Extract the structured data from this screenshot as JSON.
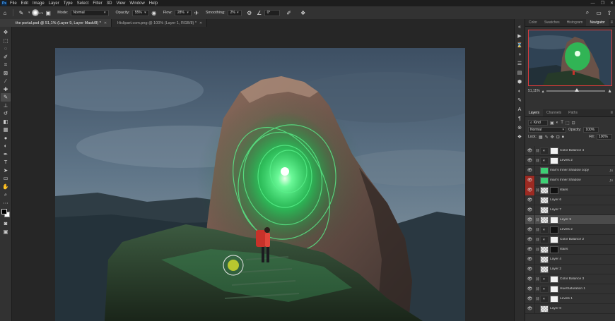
{
  "menubar": {
    "logo": "Ps",
    "items": [
      "File",
      "Edit",
      "Image",
      "Layer",
      "Type",
      "Select",
      "Filter",
      "3D",
      "View",
      "Window",
      "Help"
    ],
    "window_controls": [
      "—",
      "❐",
      "✕"
    ]
  },
  "options": {
    "brush_size": "175",
    "mode_label": "Mode:",
    "mode_value": "Normal",
    "opacity_label": "Opacity:",
    "opacity_value": "55%",
    "flow_label": "Flow:",
    "flow_value": "28%",
    "smoothing_label": "Smoothing:",
    "smoothing_value": "2%",
    "angle_value": "0°"
  },
  "tabs": [
    {
      "label": "the portal.psd @ 51,1% (Layer 9, Layer Mask/8) *",
      "active": true
    },
    {
      "label": "Hiclipart.com.png @ 100% (Layer 1, RGB/8) *",
      "active": false
    }
  ],
  "panels": {
    "top_tabs": [
      "Color",
      "Swatches",
      "Histogram",
      "Navigator"
    ],
    "active_top_tab": "Navigator",
    "zoom": "51,11%",
    "layer_tabs": [
      "Layers",
      "Channels",
      "Paths"
    ],
    "active_layer_tab": "Layers",
    "kind_filter": "Kind",
    "blend_mode": "Normal",
    "opacity_label": "Opacity:",
    "opacity_value": "100%",
    "lock_label": "Lock:",
    "fill_label": "Fill:",
    "fill_value": "100%",
    "layers": [
      {
        "name": "Color Balance 4",
        "thumb": "adj",
        "mask": "white",
        "eye_red": false,
        "selected": false,
        "fx": false
      },
      {
        "name": "Levels 2",
        "thumb": "adj",
        "mask": "white",
        "eye_red": false,
        "selected": false,
        "fx": false
      },
      {
        "name": "man's Inner Shadow copy",
        "thumb": "green",
        "mask": "",
        "eye_red": false,
        "selected": false,
        "fx": true
      },
      {
        "name": "man's Inner Shadow",
        "thumb": "green",
        "mask": "",
        "eye_red": true,
        "selected": false,
        "fx": true
      },
      {
        "name": "stairs",
        "thumb": "checker",
        "mask": "black",
        "eye_red": true,
        "selected": false,
        "fx": false
      },
      {
        "name": "Layer 6",
        "thumb": "checker",
        "mask": "",
        "eye_red": false,
        "selected": false,
        "fx": false
      },
      {
        "name": "Layer 7",
        "thumb": "checker",
        "mask": "",
        "eye_red": false,
        "selected": false,
        "fx": false
      },
      {
        "name": "Layer 9",
        "thumb": "checker",
        "mask": "white",
        "eye_red": false,
        "selected": true,
        "fx": false
      },
      {
        "name": "Levels 2",
        "thumb": "adj",
        "mask": "black",
        "eye_red": false,
        "selected": false,
        "fx": false
      },
      {
        "name": "Color Balance 2",
        "thumb": "adj",
        "mask": "white",
        "eye_red": false,
        "selected": false,
        "fx": false
      },
      {
        "name": "stairs",
        "thumb": "checker",
        "mask": "black",
        "eye_red": false,
        "selected": false,
        "fx": false
      },
      {
        "name": "Layer 4",
        "thumb": "checker",
        "mask": "",
        "eye_red": false,
        "selected": false,
        "fx": false
      },
      {
        "name": "Layer 2",
        "thumb": "checker",
        "mask": "",
        "eye_red": false,
        "selected": false,
        "fx": false
      },
      {
        "name": "Color Balance 3",
        "thumb": "adj",
        "mask": "white",
        "eye_red": false,
        "selected": false,
        "fx": false
      },
      {
        "name": "Hue/Saturation 1",
        "thumb": "adj",
        "mask": "white",
        "eye_red": false,
        "selected": false,
        "fx": false
      },
      {
        "name": "Levels 1",
        "thumb": "adj",
        "mask": "white",
        "eye_red": false,
        "selected": false,
        "fx": false
      },
      {
        "name": "Layer 0",
        "thumb": "checker",
        "mask": "",
        "eye_red": false,
        "selected": false,
        "fx": false
      }
    ]
  },
  "colors": {
    "portal_glow": "#2cf06a",
    "eye_highlight": "#9c2a22",
    "navigator_frame": "#e03a3a"
  }
}
